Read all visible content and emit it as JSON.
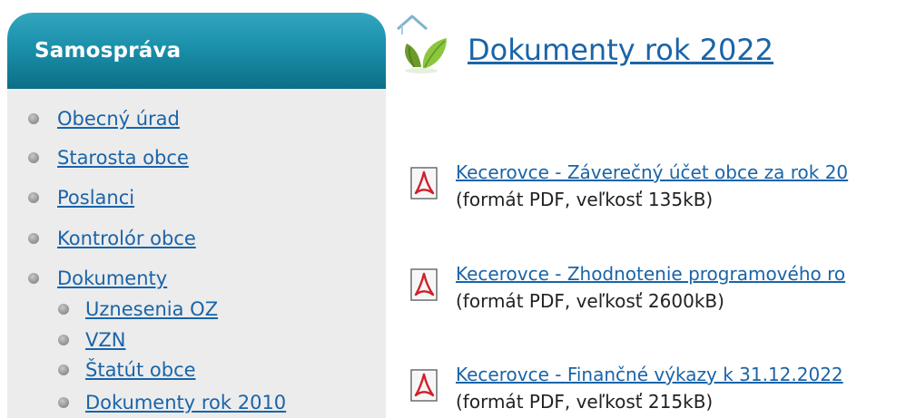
{
  "sidebar": {
    "title": "Samospráva",
    "items": [
      {
        "label": "Obecný úrad"
      },
      {
        "label": "Starosta obce"
      },
      {
        "label": "Poslanci"
      },
      {
        "label": "Kontrolór obce"
      },
      {
        "label": "Dokumenty"
      }
    ],
    "subitems": [
      {
        "label": "Uznesenia OZ"
      },
      {
        "label": "VZN"
      },
      {
        "label": "Štatút obce"
      },
      {
        "label": "Dokumenty rok 2010"
      }
    ]
  },
  "main": {
    "title": "Dokumenty rok 2022",
    "documents": [
      {
        "title": "Kecerovce - Záverečný účet obce za rok 20",
        "meta": "(formát PDF, veľkosť 135kB)"
      },
      {
        "title": "Kecerovce - Zhodnotenie programového ro",
        "meta": "(formát PDF, veľkosť 2600kB)"
      },
      {
        "title": "Kecerovce - Finančné výkazy k 31.12.2022",
        "meta": "(formát PDF, veľkosť 215kB)"
      }
    ]
  },
  "colors": {
    "header_teal": "#1b90ab",
    "link_blue": "#1a64a8",
    "sidebar_bg": "#ececec",
    "pdf_red": "#d0202a"
  },
  "icons": {
    "logo": "house-leaf-logo-icon",
    "document": "pdf-icon",
    "bullet": "bullet-icon"
  }
}
